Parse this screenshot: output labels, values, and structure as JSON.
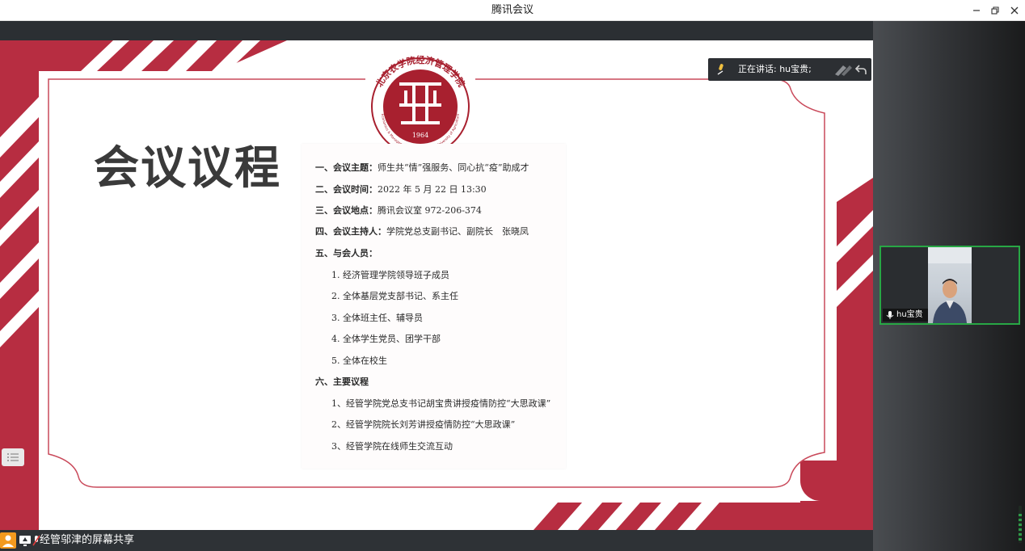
{
  "window": {
    "title": "腾讯会议"
  },
  "slide": {
    "title": "会议议程",
    "agenda": [
      {
        "label": "一、会议主题：",
        "text": "师生共“情”强服务、同心抗“疫”助成才"
      },
      {
        "label": "二、会议时间：",
        "text": "2022 年 5 月 22 日 13:30"
      },
      {
        "label": "三、会议地点：",
        "text": "腾讯会议室 972-206-374"
      },
      {
        "label": "四、会议主持人：",
        "text": "学院党总支副书记、副院长　张晓凤"
      },
      {
        "label": "五、与会人员：",
        "text": ""
      },
      {
        "label": "",
        "text": "1. 经济管理学院领导班子成员"
      },
      {
        "label": "",
        "text": "2. 全体基层党支部书记、系主任"
      },
      {
        "label": "",
        "text": "3. 全体班主任、辅导员"
      },
      {
        "label": "",
        "text": "4. 全体学生党员、团学干部"
      },
      {
        "label": "",
        "text": "5. 全体在校生"
      },
      {
        "label": "六、主要议程",
        "text": ""
      },
      {
        "label": "",
        "text": "1、经管学院党总支书记胡宝贵讲授疫情防控“大思政课”"
      },
      {
        "label": "",
        "text": "2、经管学院院长刘芳讲授疫情防控“大思政课”"
      },
      {
        "label": "",
        "text": "3、经管学院在线师生交流互动"
      }
    ],
    "logo": {
      "ring_text": "北京农学院经济管理学院",
      "ring_text_en": "Economics & Management School of Beijing University of Agriculture",
      "year": "1964"
    }
  },
  "speaking": {
    "text": "正在讲话: hu宝贵;"
  },
  "participant": {
    "name": "hu宝贵"
  },
  "share": {
    "label": "经管邬津的屏幕共享"
  },
  "colors": {
    "accent_red": "#b72d41",
    "active_green": "#28a745",
    "toolbar_dark": "#2e3236"
  }
}
